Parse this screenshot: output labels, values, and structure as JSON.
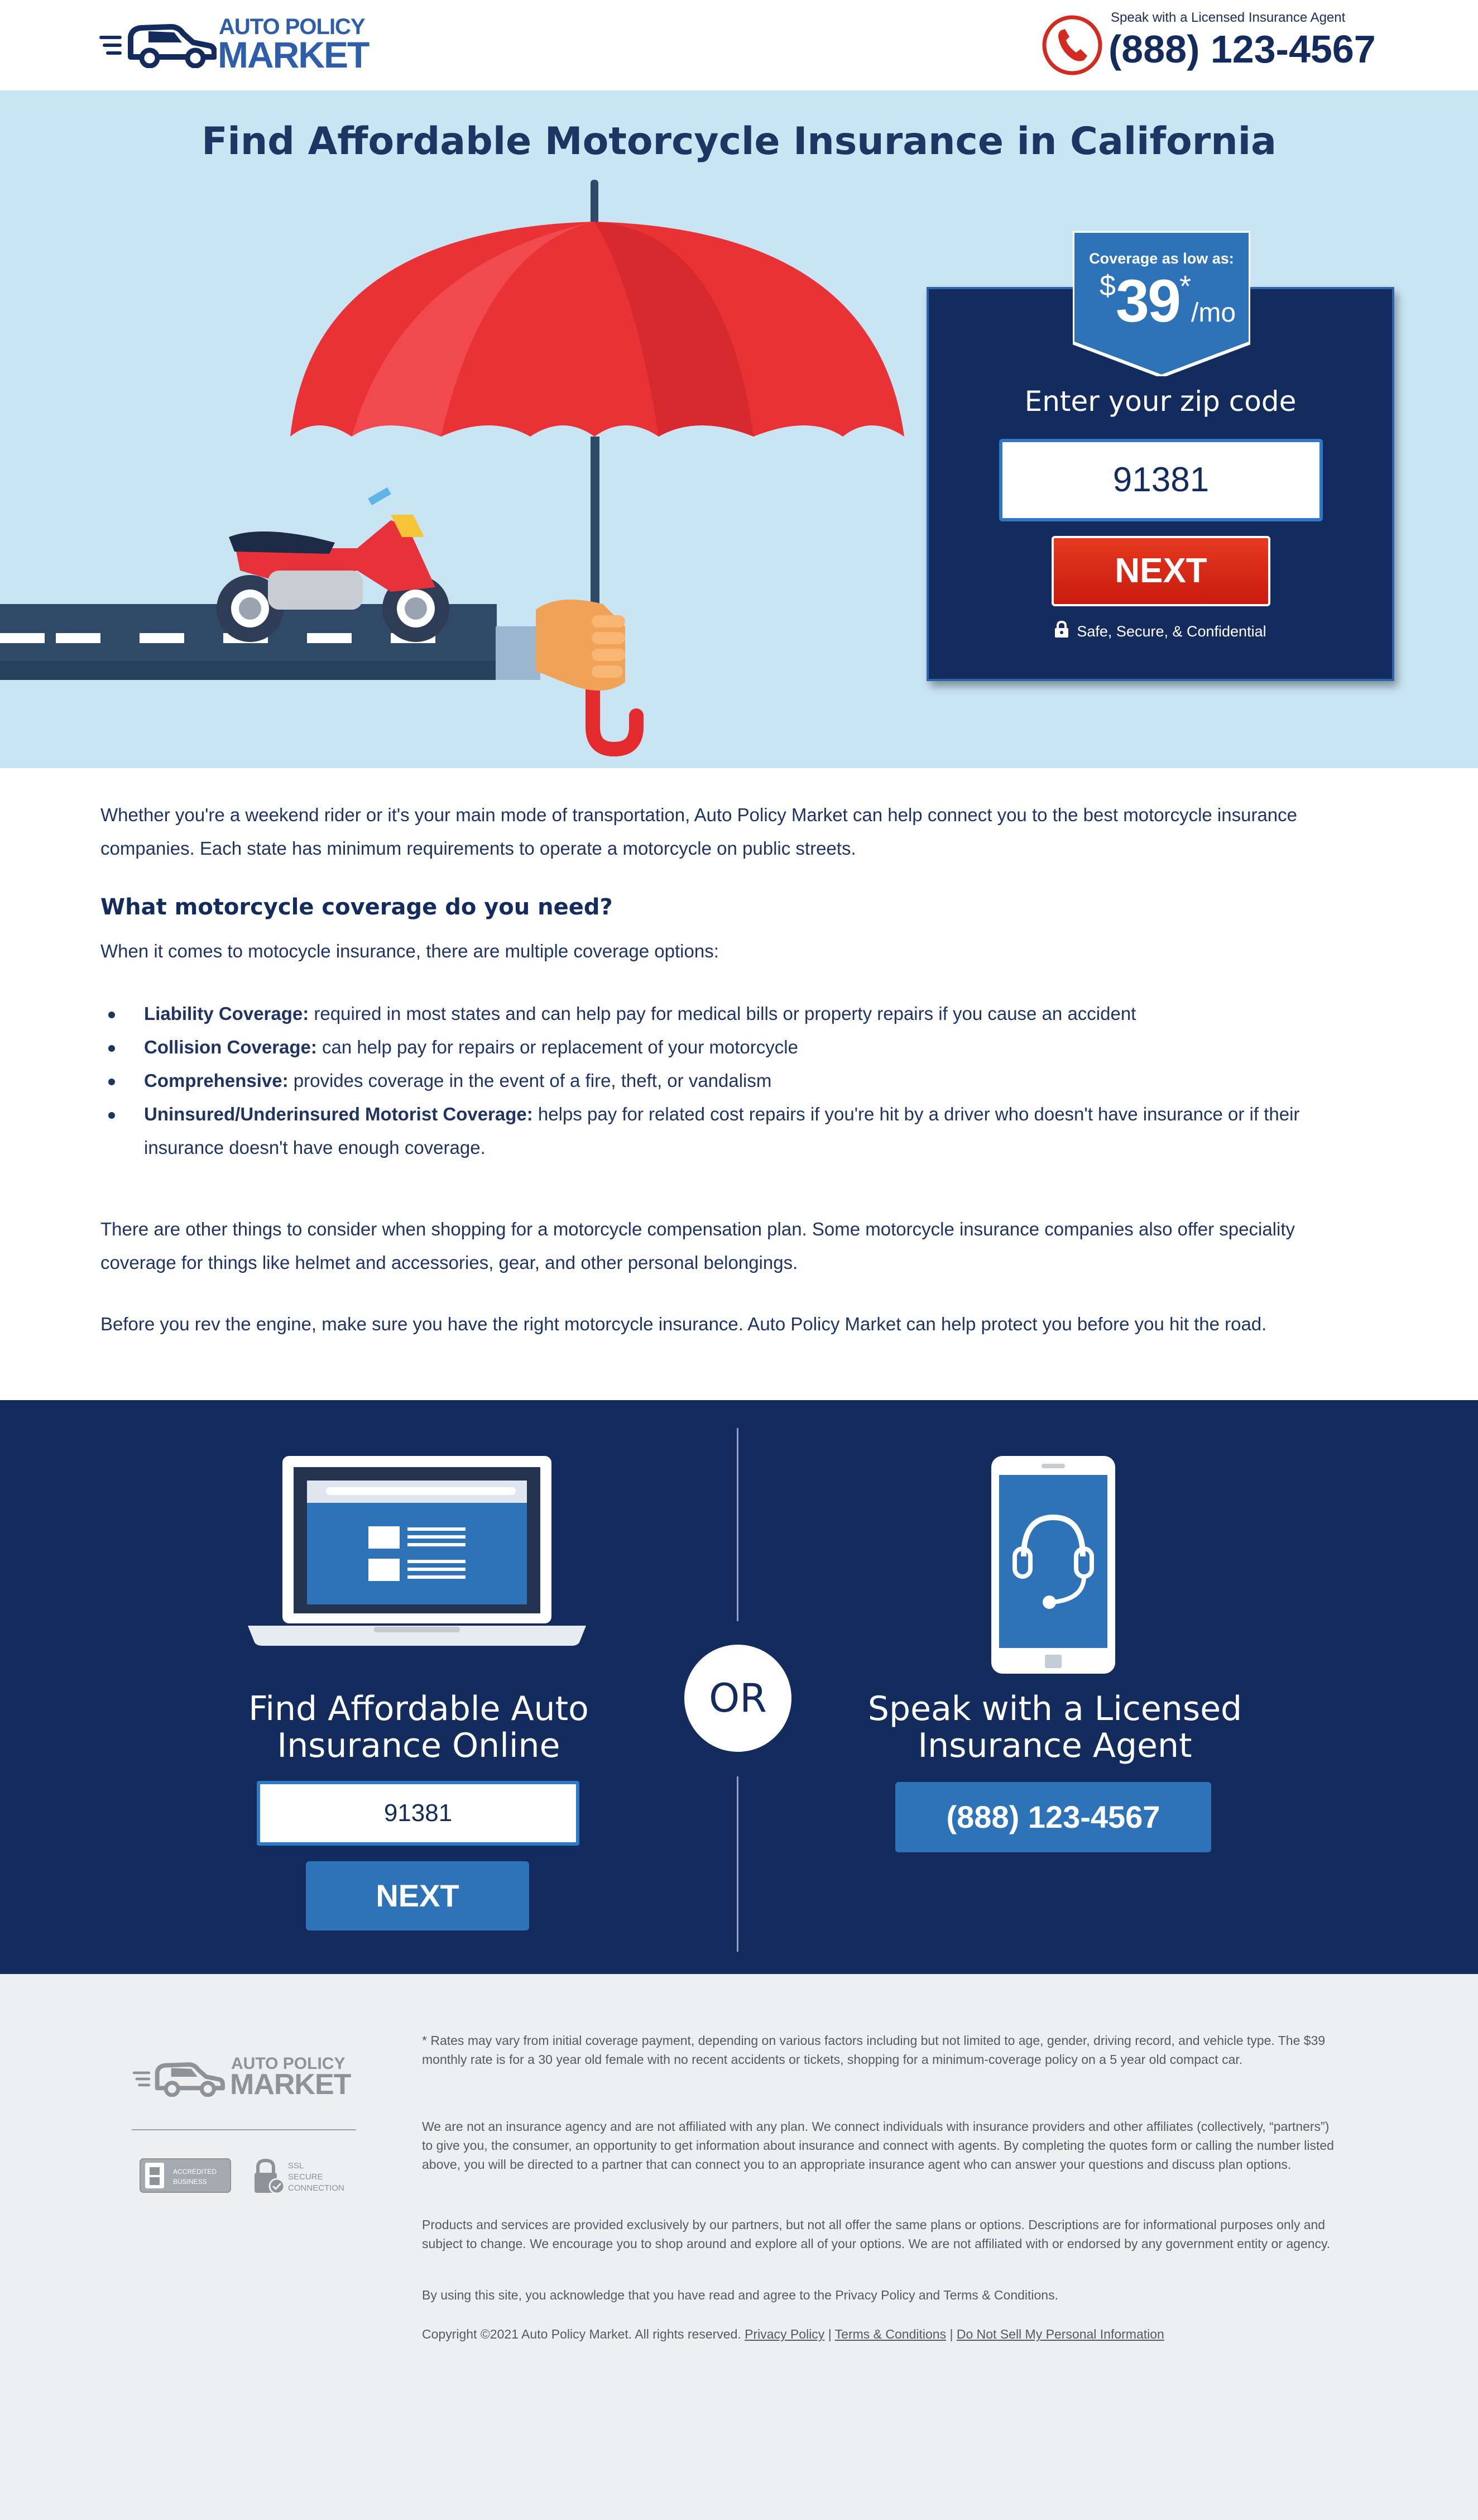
{
  "header": {
    "logo_top": "AUTO POLICY",
    "logo_bottom": "MARKET",
    "agent_label": "Speak with a Licensed Insurance Agent",
    "phone": "(888) 123-4567"
  },
  "hero": {
    "title": "Find Affordable Motorcycle Insurance in California",
    "badge_label": "Coverage as low as:",
    "badge_currency": "$",
    "badge_amount": "39",
    "badge_star": "*",
    "badge_period": "/mo",
    "zip_label": "Enter your zip code",
    "zip_value": "91381",
    "next_label": "NEXT",
    "secure_label": "Safe, Secure, & Confidential"
  },
  "content": {
    "intro": "Whether you're a weekend rider or it's your main mode of transportation, Auto Policy Market can help connect you to the best motorcycle insurance companies. Each state has minimum requirements to operate a motorcycle on public streets.",
    "heading": "What motorcycle coverage do you need?",
    "lead": "When it comes to motocycle insurance, there are multiple coverage options:",
    "bullets": [
      {
        "term": "Liability Coverage:",
        "text": " required in most states and can help pay for medical bills or property repairs if you cause an accident"
      },
      {
        "term": "Collision Coverage:",
        "text": " can help pay for repairs or replacement of your motorcycle"
      },
      {
        "term": "Comprehensive:",
        "text": " provides coverage in the event of a fire, theft, or vandalism"
      },
      {
        "term": "Uninsured/Underinsured Motorist Coverage:",
        "text": " helps pay for related cost repairs if you're hit by a driver who doesn't have insurance or if their insurance doesn't have enough coverage."
      }
    ],
    "other": "There are other things to consider when shopping for a motorcycle compensation plan. Some motorcycle insurance companies also offer speciality coverage for things like helmet and accessories, gear, and other personal belongings.",
    "closing": "Before you rev the engine, make sure you have the right motorcycle insurance. Auto Policy Market can help protect you before you hit the road."
  },
  "band": {
    "left_title_line1": "Find Affordable Auto",
    "left_title_line2": "Insurance Online",
    "zip_value": "91381",
    "next_label": "NEXT",
    "or_label": "OR",
    "right_title_line1": "Speak with a Licensed",
    "right_title_line2": "Insurance Agent",
    "phone": "(888) 123-4567"
  },
  "footer": {
    "logo_top": "AUTO POLICY",
    "logo_bottom": "MARKET",
    "bbb_line1": "ACCREDITED",
    "bbb_line2": "BUSINESS",
    "ssl_line1": "SSL",
    "ssl_line2": "SECURE",
    "ssl_line3": "CONNECTION",
    "disclaimer1": "* Rates may vary from initial coverage payment, depending on various factors including but not limited to age, gender, driving record, and vehicle type. The $39 monthly rate is for a 30 year old female with no recent accidents or tickets, shopping for a minimum-coverage policy on a 5 year old compact car.",
    "disclaimer2": "We are not an insurance agency and are not affiliated with any plan. We connect individuals with insurance providers and other affiliates (collectively, “partners”) to give you, the consumer, an opportunity to get information about insurance and connect with agents. By completing the quotes form or calling the number listed above, you will be directed to a partner that can connect you to an appropriate insurance agent who can answer your questions and discuss plan options.",
    "disclaimer3": "Products and services are provided exclusively by our partners, but not all offer the same plans or options. Descriptions are for informational purposes only and subject to change. We encourage you to shop around and explore all of your options. We are not affiliated with or endorsed by any government entity or agency.",
    "disclaimer4": "By using this site, you acknowledge that you have read and agree to the Privacy Policy and Terms & Conditions.",
    "copyright": "Copyright ©2021 Auto Policy Market. All rights reserved. ",
    "link_privacy": "Privacy Policy",
    "link_terms": "Terms & Conditions",
    "link_dns": "Do Not Sell My Personal Information",
    "separator": " | "
  },
  "colors": {
    "navy": "#132b5d",
    "brand_blue": "#2e5ea8",
    "hero_bg": "#c9e5f3",
    "next_red": "#d9281a",
    "button_blue": "#2e72b8",
    "footer_bg": "#edeff1"
  },
  "icons": [
    "logo-car-icon",
    "phone-icon",
    "umbrella-icon",
    "motorcycle-icon",
    "lock-icon",
    "laptop-icon",
    "headset-phone-icon",
    "bbb-icon",
    "ssl-lock-icon"
  ]
}
